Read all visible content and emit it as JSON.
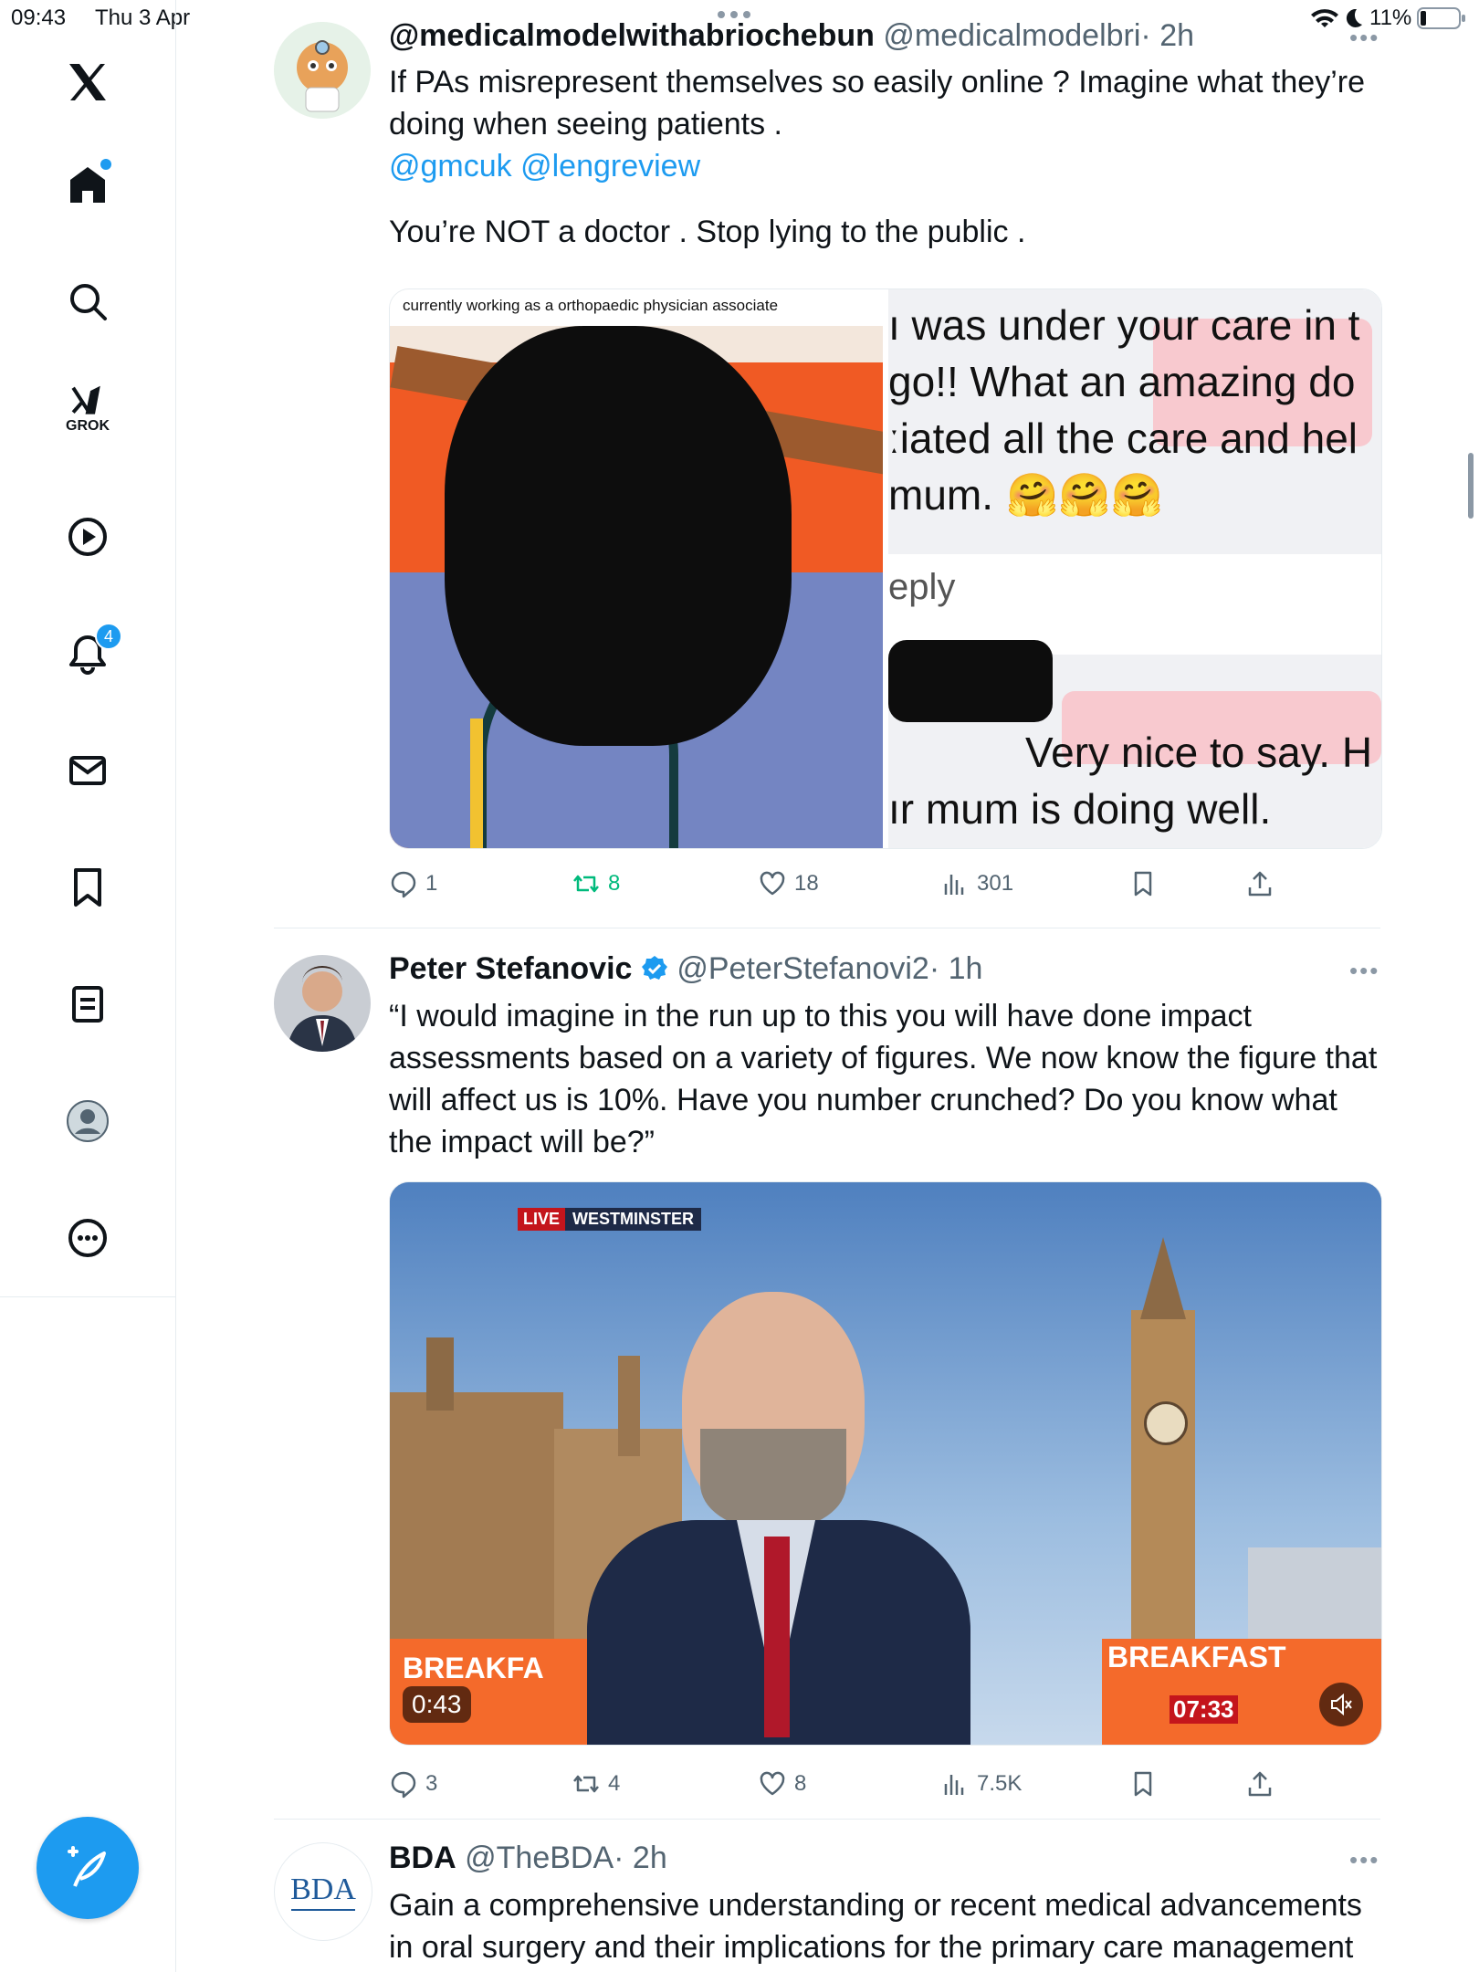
{
  "status_bar": {
    "time": "09:43",
    "date": "Thu 3 Apr",
    "battery": "11%"
  },
  "sidebar": {
    "items": [
      {
        "name": "x-logo"
      },
      {
        "name": "home"
      },
      {
        "name": "search"
      },
      {
        "name": "grok",
        "label": "GROK"
      },
      {
        "name": "videos"
      },
      {
        "name": "notifications",
        "badge": "4"
      },
      {
        "name": "messages"
      },
      {
        "name": "bookmarks"
      },
      {
        "name": "lists"
      },
      {
        "name": "profile"
      },
      {
        "name": "more"
      }
    ],
    "accent": "#1d9bf0"
  },
  "tweets": [
    {
      "name": "@medicalmodelwithabriochebun",
      "handle": "@medicalmodelbri",
      "time": "· 2h",
      "text_line1": "If PAs misrepresent themselves so easily online ? Imagine what they’re",
      "text_line2": "doing when seeing patients .",
      "mentions": "@gmcuk @lengreview",
      "text_line3": "You’re NOT a doctor . Stop lying to the public .",
      "image_left_caption": "currently working as a orthopaedic physician associate",
      "image_right_lines": [
        "ı was under your care in t",
        "go!! What an amazing do",
        "ːiated all the care and hel",
        "mum.",
        "eply",
        "Very nice to say. H",
        "ır mum is doing well."
      ],
      "stats": {
        "replies": "1",
        "reposts": "8",
        "likes": "18",
        "views": "301"
      }
    },
    {
      "name": "Peter Stefanovic",
      "handle": "@PeterStefanovi2",
      "time": "· 1h",
      "text_lines": [
        "“I would imagine in the run up to this you will have done impact",
        "assessments based on a variety of figures. We now know the figure that",
        "will affect us is 10%. Have you number crunched? Do you know what",
        "the impact will be?”"
      ],
      "video": {
        "live_label": "LIVE",
        "location_label": "WESTMINSTER",
        "left_banner": "BREAKFA",
        "right_banner": "BREAKFAST",
        "clock": "07:33",
        "duration": "0:43"
      },
      "stats": {
        "replies": "3",
        "reposts": "4",
        "likes": "8",
        "views": "7.5K"
      }
    },
    {
      "name": "BDA",
      "handle": "@TheBDA",
      "time": "· 2h",
      "avatar_text": "BDA",
      "text_lines": [
        "Gain a comprehensive understanding or recent medical advancements",
        "in oral surgery and their implications for the primary care management"
      ]
    }
  ]
}
